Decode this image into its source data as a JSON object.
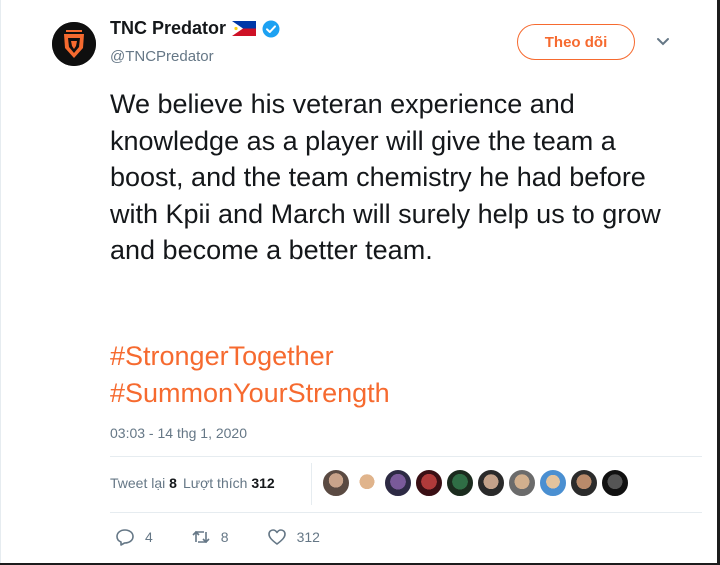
{
  "account": {
    "display_name": "TNC Predator",
    "handle": "@TNCPredator",
    "flag_icon": "philippines-flag-icon",
    "verified_icon": "verified-badge-icon"
  },
  "follow_button": {
    "label": "Theo dõi"
  },
  "tweet": {
    "text": "We believe his veteran experience and knowledge as a player will give the team a boost, and the team chemistry he had before with Kpii and March will surely help us to grow and become a better team.",
    "hashtags": [
      "#StrongerTogether",
      "#SummonYourStrength"
    ],
    "timestamp": "03:03 - 14 thg 1, 2020"
  },
  "stats": {
    "retweets_label": "Tweet lại",
    "retweets_count": "8",
    "likes_label": "Lượt thích",
    "likes_count": "312"
  },
  "actions": {
    "reply_count": "4",
    "retweet_count": "8",
    "like_count": "312"
  },
  "colors": {
    "accent": "#f66a2f",
    "text": "#14171a",
    "muted": "#657786",
    "verified": "#1da1f2"
  }
}
